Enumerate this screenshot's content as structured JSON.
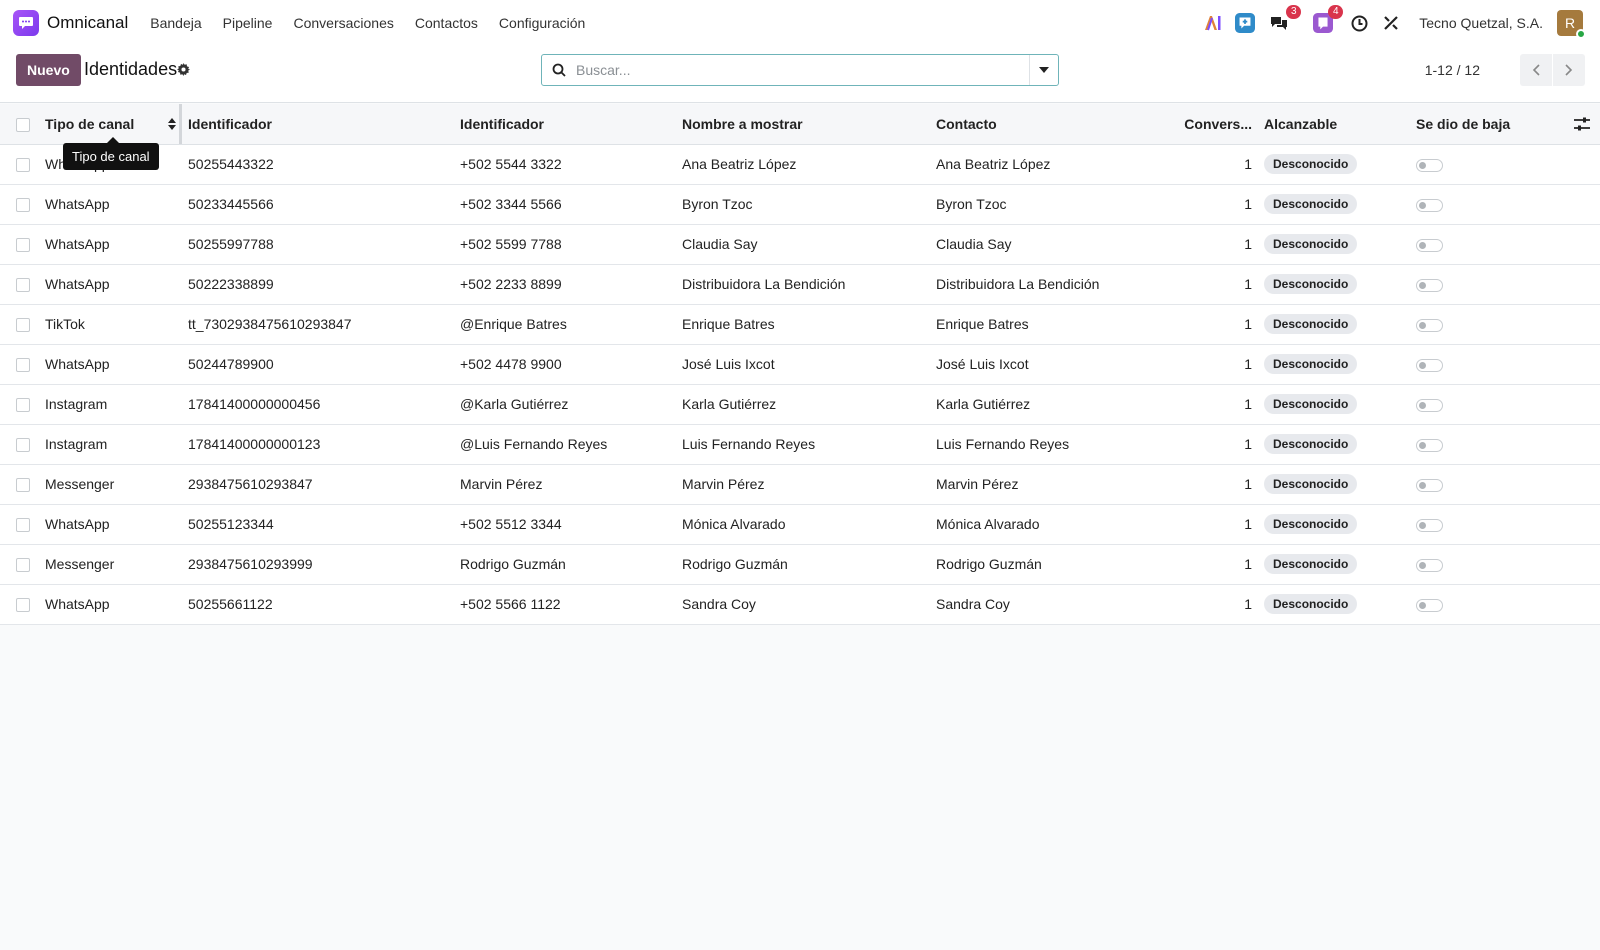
{
  "navbar": {
    "app_name": "Omnicanal",
    "menu": [
      "Bandeja",
      "Pipeline",
      "Conversaciones",
      "Contactos",
      "Configuración"
    ],
    "badges": {
      "messages": "3",
      "activities": "4"
    },
    "company": "Tecno Quetzal, S.A.",
    "avatar_letter": "R"
  },
  "control": {
    "new_label": "Nuevo",
    "title": "Identidades",
    "search_placeholder": "Buscar...",
    "pager": "1-12 / 12"
  },
  "table": {
    "columns": [
      "Tipo de canal",
      "Identificador",
      "Identificador",
      "Nombre a mostrar",
      "Contacto",
      "Convers...",
      "Alcanzable",
      "Se dio de baja"
    ],
    "rows": [
      {
        "channel": "WhatsApp",
        "ident": "50255443322",
        "handle": "+502 5544 3322",
        "display": "Ana Beatriz López",
        "contact": "Ana Beatriz López",
        "convs": "1",
        "reach": "Desconocido"
      },
      {
        "channel": "WhatsApp",
        "ident": "50233445566",
        "handle": "+502 3344 5566",
        "display": "Byron Tzoc",
        "contact": "Byron Tzoc",
        "convs": "1",
        "reach": "Desconocido"
      },
      {
        "channel": "WhatsApp",
        "ident": "50255997788",
        "handle": "+502 5599 7788",
        "display": "Claudia Say",
        "contact": "Claudia Say",
        "convs": "1",
        "reach": "Desconocido"
      },
      {
        "channel": "WhatsApp",
        "ident": "50222338899",
        "handle": "+502 2233 8899",
        "display": "Distribuidora La Bendición",
        "contact": "Distribuidora La Bendición",
        "convs": "1",
        "reach": "Desconocido"
      },
      {
        "channel": "TikTok",
        "ident": "tt_7302938475610293847",
        "handle": "@Enrique Batres",
        "display": "Enrique Batres",
        "contact": "Enrique Batres",
        "convs": "1",
        "reach": "Desconocido"
      },
      {
        "channel": "WhatsApp",
        "ident": "50244789900",
        "handle": "+502 4478 9900",
        "display": "José Luis Ixcot",
        "contact": "José Luis Ixcot",
        "convs": "1",
        "reach": "Desconocido"
      },
      {
        "channel": "Instagram",
        "ident": "17841400000000456",
        "handle": "@Karla Gutiérrez",
        "display": "Karla Gutiérrez",
        "contact": "Karla Gutiérrez",
        "convs": "1",
        "reach": "Desconocido"
      },
      {
        "channel": "Instagram",
        "ident": "17841400000000123",
        "handle": "@Luis Fernando Reyes",
        "display": "Luis Fernando Reyes",
        "contact": "Luis Fernando Reyes",
        "convs": "1",
        "reach": "Desconocido"
      },
      {
        "channel": "Messenger",
        "ident": "2938475610293847",
        "handle": "Marvin Pérez",
        "display": "Marvin Pérez",
        "contact": "Marvin Pérez",
        "convs": "1",
        "reach": "Desconocido"
      },
      {
        "channel": "WhatsApp",
        "ident": "50255123344",
        "handle": "+502 5512 3344",
        "display": "Mónica Alvarado",
        "contact": "Mónica Alvarado",
        "convs": "1",
        "reach": "Desconocido"
      },
      {
        "channel": "Messenger",
        "ident": "2938475610293999",
        "handle": "Rodrigo Guzmán",
        "display": "Rodrigo Guzmán",
        "contact": "Rodrigo Guzmán",
        "convs": "1",
        "reach": "Desconocido"
      },
      {
        "channel": "WhatsApp",
        "ident": "50255661122",
        "handle": "+502 5566 1122",
        "display": "Sandra Coy",
        "contact": "Sandra Coy",
        "convs": "1",
        "reach": "Desconocido"
      }
    ]
  },
  "tooltip": "Tipo de canal",
  "colors": {
    "primary": "#714b67",
    "badge": "#d9344c",
    "logo": "#7c3aed"
  }
}
